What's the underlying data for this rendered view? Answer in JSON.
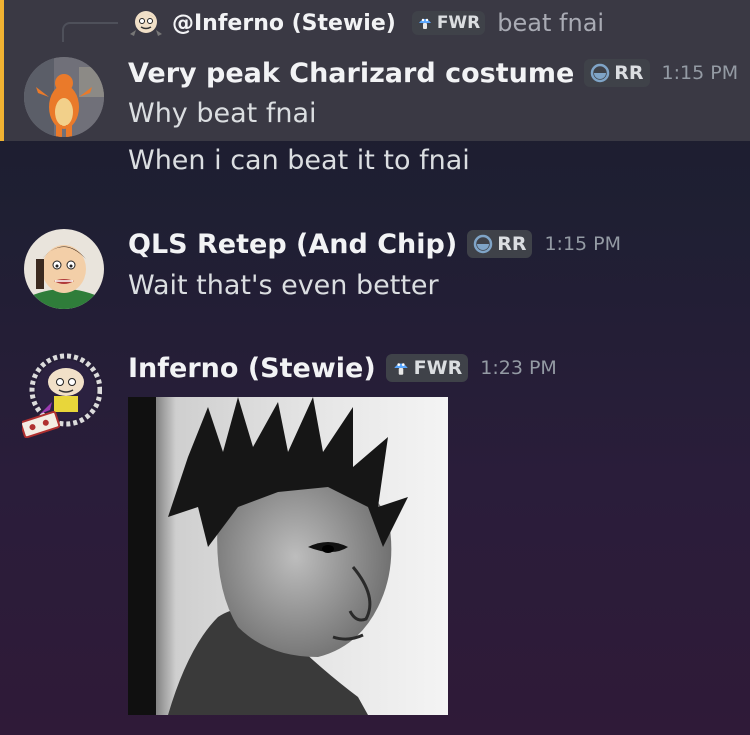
{
  "reply": {
    "author": "@Inferno (Stewie)",
    "tag": "FWR",
    "text": "beat fnai",
    "avatar_icon": "stewie-avatar"
  },
  "messages": [
    {
      "author": "Very peak Charizard costume",
      "tag": "RR",
      "tag_icon": "moon-ring-icon",
      "time": "1:15 PM",
      "avatar_icon": "charizard-costume-avatar",
      "lines": [
        "Why beat fnai",
        "When i can beat it to fnai"
      ],
      "mentioned": true
    },
    {
      "author": "QLS Retep (And Chip)",
      "tag": "RR",
      "tag_icon": "moon-ring-icon",
      "time": "1:15 PM",
      "avatar_icon": "peter-avatar",
      "lines": [
        "Wait that's even better"
      ]
    },
    {
      "author": "Inferno (Stewie)",
      "tag": "FWR",
      "tag_icon": "mushroom-icon",
      "time": "1:23 PM",
      "avatar_icon": "stewie-avatar",
      "attachment": "grayscale-photo"
    }
  ],
  "colors": {
    "mention_bar": "#f0b232",
    "highlight_bg": "#3a3944",
    "fwr_icon": "#5aa7ff",
    "rr_icon": "#7fa4c7"
  }
}
